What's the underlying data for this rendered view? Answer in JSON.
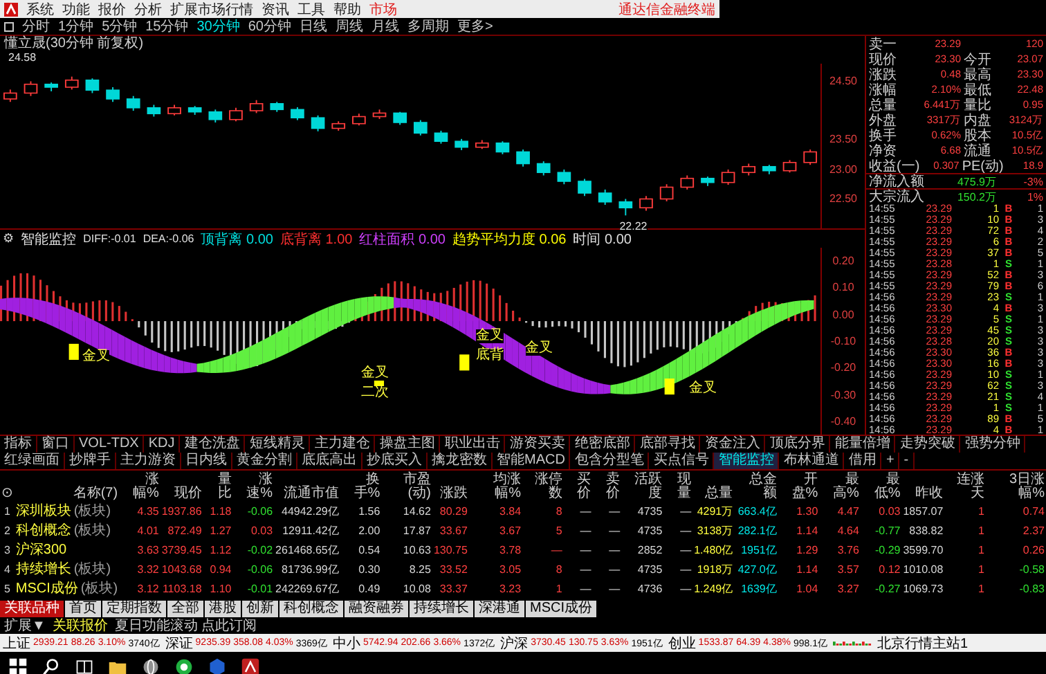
{
  "menu": {
    "items": [
      {
        "label": "系统",
        "selected": false
      },
      {
        "label": "功能",
        "selected": false
      },
      {
        "label": "报价",
        "selected": false
      },
      {
        "label": "分析",
        "selected": false
      },
      {
        "label": "扩展市场行情",
        "selected": false
      },
      {
        "label": "资讯",
        "selected": false
      },
      {
        "label": "工具",
        "selected": false
      },
      {
        "label": "帮助",
        "selected": false
      },
      {
        "label": "市场",
        "selected": true
      }
    ],
    "app_title": "通达信金融终端"
  },
  "periods": [
    {
      "label": "分时",
      "selected": false
    },
    {
      "label": "1分钟",
      "selected": false
    },
    {
      "label": "5分钟",
      "selected": false
    },
    {
      "label": "15分钟",
      "selected": false
    },
    {
      "label": "30分钟",
      "selected": true
    },
    {
      "label": "60分钟",
      "selected": false
    },
    {
      "label": "日线",
      "selected": false
    },
    {
      "label": "周线",
      "selected": false
    },
    {
      "label": "月线",
      "selected": false
    },
    {
      "label": "多周期",
      "selected": false
    },
    {
      "label": "更多>",
      "selected": false
    }
  ],
  "chart": {
    "title": "懂立晟(30分钟 前复权)",
    "high_label": "24.58",
    "low_label": "22.22",
    "chart_data": {
      "type": "candlestick",
      "ylim": [
        22.0,
        24.8
      ],
      "yticks": [
        {
          "value": 24.5,
          "label": "24.50"
        },
        {
          "value": 23.5,
          "label": "23.50"
        },
        {
          "value": 23.0,
          "label": "23.00"
        },
        {
          "value": 22.5,
          "label": "22.50"
        }
      ],
      "ohlc": [
        [
          24.2,
          24.36,
          24.15,
          24.3
        ],
        [
          24.3,
          24.5,
          24.25,
          24.45
        ],
        [
          24.45,
          24.48,
          24.33,
          24.4
        ],
        [
          24.4,
          24.58,
          24.36,
          24.52
        ],
        [
          24.52,
          24.55,
          24.3,
          24.35
        ],
        [
          24.35,
          24.4,
          24.15,
          24.2
        ],
        [
          24.2,
          24.25,
          24.0,
          24.05
        ],
        [
          24.05,
          24.1,
          23.9,
          23.95
        ],
        [
          23.95,
          24.1,
          23.92,
          24.05
        ],
        [
          24.05,
          24.08,
          23.93,
          23.98
        ],
        [
          23.98,
          24.02,
          23.8,
          23.85
        ],
        [
          23.85,
          24.05,
          23.82,
          24.0
        ],
        [
          24.0,
          24.18,
          23.96,
          24.12
        ],
        [
          24.12,
          24.15,
          23.98,
          24.02
        ],
        [
          24.02,
          24.06,
          23.84,
          23.88
        ],
        [
          23.88,
          23.92,
          23.65,
          23.7
        ],
        [
          23.7,
          23.82,
          23.66,
          23.78
        ],
        [
          23.78,
          23.95,
          23.75,
          23.9
        ],
        [
          23.9,
          24.02,
          23.86,
          23.96
        ],
        [
          23.96,
          23.98,
          23.76,
          23.8
        ],
        [
          23.8,
          23.84,
          23.58,
          23.62
        ],
        [
          23.62,
          23.66,
          23.44,
          23.48
        ],
        [
          23.48,
          23.52,
          23.33,
          23.38
        ],
        [
          23.38,
          23.5,
          23.35,
          23.45
        ],
        [
          23.45,
          23.48,
          23.26,
          23.3
        ],
        [
          23.3,
          23.34,
          23.05,
          23.1
        ],
        [
          23.1,
          23.14,
          22.9,
          22.95
        ],
        [
          22.95,
          23.0,
          22.75,
          22.8
        ],
        [
          22.8,
          22.84,
          22.55,
          22.6
        ],
        [
          22.6,
          22.66,
          22.4,
          22.45
        ],
        [
          22.45,
          22.5,
          22.22,
          22.35
        ],
        [
          22.35,
          22.55,
          22.3,
          22.5
        ],
        [
          22.5,
          22.75,
          22.46,
          22.7
        ],
        [
          22.7,
          22.9,
          22.66,
          22.85
        ],
        [
          22.85,
          22.88,
          22.72,
          22.78
        ],
        [
          22.78,
          23.0,
          22.74,
          22.95
        ],
        [
          22.95,
          23.1,
          22.9,
          23.05
        ],
        [
          23.05,
          23.08,
          22.92,
          22.98
        ],
        [
          22.98,
          23.16,
          22.95,
          23.12
        ],
        [
          23.12,
          23.34,
          23.08,
          23.3
        ]
      ]
    }
  },
  "indicator": {
    "icon": "⚙",
    "name": "智能监控",
    "diff": "DIFF:-0.01",
    "dea": "DEA:-0.06",
    "metrics": [
      {
        "label": "顶背离",
        "value": "0.00",
        "color": "#00e0e0"
      },
      {
        "label": "底背离",
        "value": "1.00",
        "color": "#ff3030"
      },
      {
        "label": "红柱面积",
        "value": "0.00",
        "color": "#d040ff"
      },
      {
        "label": "趋势平均力度",
        "value": "0.06",
        "color": "#ffff00"
      },
      {
        "label": "时间",
        "value": "0.00",
        "color": "#e0e0e0"
      }
    ],
    "axis": [
      "0.20",
      "0.10",
      "0.00",
      "-0.10",
      "-0.20",
      "-0.30",
      "-0.40"
    ],
    "signals": [
      "金叉",
      "金叉",
      "二次",
      "金叉",
      "底背",
      "金叉",
      "金叉"
    ]
  },
  "quote": {
    "rows": [
      {
        "label": "卖一",
        "value": "23.29",
        "label2": "",
        "value2": "120"
      },
      {
        "label": "现价",
        "value": "23.30",
        "label2": "今开",
        "value2": "23.07"
      },
      {
        "label": "涨跌",
        "value": "0.48",
        "label2": "最高",
        "value2": "23.30"
      },
      {
        "label": "涨幅",
        "value": "2.10%",
        "label2": "最低",
        "value2": "22.48"
      },
      {
        "label": "总量",
        "value": "6.441万",
        "label2": "量比",
        "value2": "0.95"
      },
      {
        "label": "外盘",
        "value": "3317万",
        "label2": "内盘",
        "value2": "3124万"
      },
      {
        "label": "换手",
        "value": "0.62%",
        "label2": "股本",
        "value2": "10.5亿"
      },
      {
        "label": "净资",
        "value": "6.68",
        "label2": "流通",
        "value2": "10.5亿"
      },
      {
        "label": "收益(一)",
        "value": "0.307",
        "label2": "PE(动)",
        "value2": "18.9"
      }
    ],
    "flows": [
      {
        "label": "净流入额",
        "value": "475.9万",
        "share": "-3%"
      },
      {
        "label": "大宗流入",
        "value": "150.2万",
        "share": "1%"
      }
    ],
    "ticks": [
      {
        "time": "14:55",
        "price": "23.29",
        "volume": "1",
        "side": "B",
        "kind": "buy",
        "count": "1"
      },
      {
        "time": "14:55",
        "price": "23.29",
        "volume": "10",
        "side": "B",
        "kind": "buy",
        "count": "3"
      },
      {
        "time": "14:55",
        "price": "23.29",
        "volume": "72",
        "side": "B",
        "kind": "buy",
        "count": "4"
      },
      {
        "time": "14:55",
        "price": "23.29",
        "volume": "6",
        "side": "B",
        "kind": "buy",
        "count": "2"
      },
      {
        "time": "14:55",
        "price": "23.29",
        "volume": "37",
        "side": "B",
        "kind": "buy",
        "count": "5"
      },
      {
        "time": "14:55",
        "price": "23.28",
        "volume": "1",
        "side": "S",
        "kind": "sell",
        "count": "1"
      },
      {
        "time": "14:55",
        "price": "23.29",
        "volume": "52",
        "side": "B",
        "kind": "buy",
        "count": "3"
      },
      {
        "time": "14:55",
        "price": "23.29",
        "volume": "79",
        "side": "B",
        "kind": "buy",
        "count": "6"
      },
      {
        "time": "14:56",
        "price": "23.29",
        "volume": "23",
        "side": "S",
        "kind": "sell",
        "count": "1"
      },
      {
        "time": "14:56",
        "price": "23.30",
        "volume": "4",
        "side": "B",
        "kind": "buy",
        "count": "3"
      },
      {
        "time": "14:56",
        "price": "23.29",
        "volume": "5",
        "side": "S",
        "kind": "sell",
        "count": "1"
      },
      {
        "time": "14:56",
        "price": "23.29",
        "volume": "45",
        "side": "S",
        "kind": "sell",
        "count": "3"
      },
      {
        "time": "14:56",
        "price": "23.28",
        "volume": "20",
        "side": "S",
        "kind": "sell",
        "count": "3"
      },
      {
        "time": "14:56",
        "price": "23.30",
        "volume": "36",
        "side": "B",
        "kind": "buy",
        "count": "3"
      },
      {
        "time": "14:56",
        "price": "23.30",
        "volume": "16",
        "side": "B",
        "kind": "buy",
        "count": "3"
      },
      {
        "time": "14:56",
        "price": "23.29",
        "volume": "10",
        "side": "S",
        "kind": "sell",
        "count": "1"
      },
      {
        "time": "14:56",
        "price": "23.29",
        "volume": "62",
        "side": "S",
        "kind": "sell",
        "count": "3"
      },
      {
        "time": "14:56",
        "price": "23.29",
        "volume": "21",
        "side": "S",
        "kind": "sell",
        "count": "4"
      },
      {
        "time": "14:56",
        "price": "23.29",
        "volume": "1",
        "side": "S",
        "kind": "sell",
        "count": "1"
      },
      {
        "time": "14:56",
        "price": "23.29",
        "volume": "89",
        "side": "B",
        "kind": "buy",
        "count": "5"
      },
      {
        "time": "14:56",
        "price": "23.29",
        "volume": "4",
        "side": "B",
        "kind": "buy",
        "count": "1"
      }
    ]
  },
  "indicator_tabs": [
    {
      "label": "指标",
      "selected": false
    },
    {
      "label": "窗口",
      "selected": false
    },
    {
      "label": "VOL-TDX",
      "selected": false
    },
    {
      "label": "KDJ",
      "selected": false
    },
    {
      "label": "建仓洗盘",
      "selected": false
    },
    {
      "label": "短线精灵",
      "selected": false
    },
    {
      "label": "主力建仓",
      "selected": false
    },
    {
      "label": "操盘主图",
      "selected": false
    },
    {
      "label": "职业出击",
      "selected": false
    },
    {
      "label": "游资买卖",
      "selected": false
    },
    {
      "label": "绝密底部",
      "selected": false
    },
    {
      "label": "底部寻找",
      "selected": false
    },
    {
      "label": "资金注入",
      "selected": false
    },
    {
      "label": "顶底分界",
      "selected": false
    },
    {
      "label": "能量倍增",
      "selected": false
    },
    {
      "label": "走势突破",
      "selected": false
    },
    {
      "label": "强势分钟",
      "selected": false
    },
    {
      "label": "红绿画面",
      "selected": false
    },
    {
      "label": "抄牌手",
      "selected": false
    },
    {
      "label": "主力游资",
      "selected": false
    },
    {
      "label": "日内线",
      "selected": false
    },
    {
      "label": "黄金分割",
      "selected": false
    },
    {
      "label": "底底高出",
      "selected": false
    },
    {
      "label": "抄底买入",
      "selected": false
    },
    {
      "label": "擒龙密数",
      "selected": false
    },
    {
      "label": "智能MACD",
      "selected": false
    },
    {
      "label": "包含分型笔",
      "selected": false
    },
    {
      "label": "买点信号",
      "selected": false
    },
    {
      "label": "智能监控",
      "selected": true
    },
    {
      "label": "布林通道",
      "selected": false
    },
    {
      "label": "借用",
      "selected": false
    },
    {
      "label": "+",
      "selected": false
    },
    {
      "label": "-",
      "selected": false
    }
  ],
  "table": {
    "columns": [
      "⊙",
      "名称(7)",
      "涨幅%",
      "现价",
      "量比",
      "涨速%",
      "流通市值",
      "换手%",
      "市盈(动)",
      "涨跌",
      "均涨幅%",
      "涨停数",
      "买价",
      "卖价",
      "活跃度",
      "现量",
      "总量",
      "总金额",
      "开盘%",
      "最高%",
      "最低%",
      "昨收",
      "连涨天",
      "3日涨幅%"
    ],
    "rows": [
      {
        "tag": "(板块)",
        "cells": [
          "1",
          "深圳板块",
          "4.35",
          "1937.86",
          "1.18",
          "-0.06",
          "44942.29亿",
          "1.56",
          "14.62",
          "80.29",
          "3.84",
          "8",
          "—",
          "—",
          "4735",
          "—",
          "4291万",
          "663.4亿",
          "1.30",
          "4.47",
          "0.03",
          "1857.07",
          "1",
          "0.74"
        ]
      },
      {
        "tag": "(板块)",
        "cells": [
          "2",
          "科创概念",
          "4.01",
          "872.49",
          "1.27",
          "0.03",
          "12911.42亿",
          "2.00",
          "17.87",
          "33.67",
          "3.67",
          "5",
          "—",
          "—",
          "4735",
          "—",
          "3138万",
          "282.1亿",
          "1.14",
          "4.64",
          "-0.77",
          "838.82",
          "1",
          "2.37"
        ]
      },
      {
        "cells": [
          "3",
          "沪深300",
          "3.63",
          "3739.45",
          "1.12",
          "-0.02",
          "261468.65亿",
          "0.54",
          "10.63",
          "130.75",
          "3.78",
          "—",
          "—",
          "—",
          "2852",
          "—",
          "1.480亿",
          "1951亿",
          "1.29",
          "3.76",
          "-0.29",
          "3599.70",
          "1",
          "0.26"
        ]
      },
      {
        "tag": "(板块)",
        "cells": [
          "4",
          "持续增长",
          "3.32",
          "1043.68",
          "0.94",
          "-0.06",
          "81736.99亿",
          "0.30",
          "8.25",
          "33.52",
          "3.05",
          "8",
          "—",
          "—",
          "4735",
          "—",
          "1918万",
          "427.0亿",
          "1.14",
          "3.57",
          "0.12",
          "1010.08",
          "1",
          "-0.58"
        ]
      },
      {
        "tag": "(板块)",
        "cells": [
          "5",
          "MSCI成份",
          "3.12",
          "1103.18",
          "1.10",
          "-0.01",
          "242269.67亿",
          "0.49",
          "10.08",
          "33.37",
          "3.23",
          "1",
          "—",
          "—",
          "4736",
          "—",
          "1.249亿",
          "1639亿",
          "1.04",
          "3.27",
          "-0.27",
          "1069.73",
          "1",
          "-0.83"
        ]
      }
    ]
  },
  "sheet_tabs": [
    {
      "label": "关联品种",
      "selected": true
    },
    {
      "label": "首页",
      "selected": false
    },
    {
      "label": "定期指数",
      "selected": false
    },
    {
      "label": "全部",
      "selected": false
    },
    {
      "label": "港股",
      "selected": false
    },
    {
      "label": "创新",
      "selected": false
    },
    {
      "label": "科创概念",
      "selected": false
    },
    {
      "label": "融资融券",
      "selected": false
    },
    {
      "label": "持续增长",
      "selected": false
    },
    {
      "label": "深港通",
      "selected": false
    },
    {
      "label": "MSCI成份",
      "selected": false
    }
  ],
  "info_bar": {
    "expand": "扩展▼",
    "linked": "关联报价",
    "notice": "夏日功能滚动 点此订阅"
  },
  "status_bar": {
    "indices": [
      {
        "name": "上证",
        "value": "2939.21",
        "change": "88.26",
        "pct": "3.10%",
        "amount": "3740亿"
      },
      {
        "name": "深证",
        "value": "9235.39",
        "change": "358.08",
        "pct": "4.03%",
        "amount": "3369亿"
      },
      {
        "name": "中小",
        "value": "5742.94",
        "change": "202.66",
        "pct": "3.66%",
        "amount": "1372亿"
      },
      {
        "name": "沪深",
        "value": "3730.45",
        "change": "130.75",
        "pct": "3.63%",
        "amount": "1951亿"
      },
      {
        "name": "创业",
        "value": "1533.87",
        "change": "64.39",
        "pct": "4.38%",
        "amount": "998.1亿"
      }
    ],
    "server": "北京行情主站1"
  }
}
